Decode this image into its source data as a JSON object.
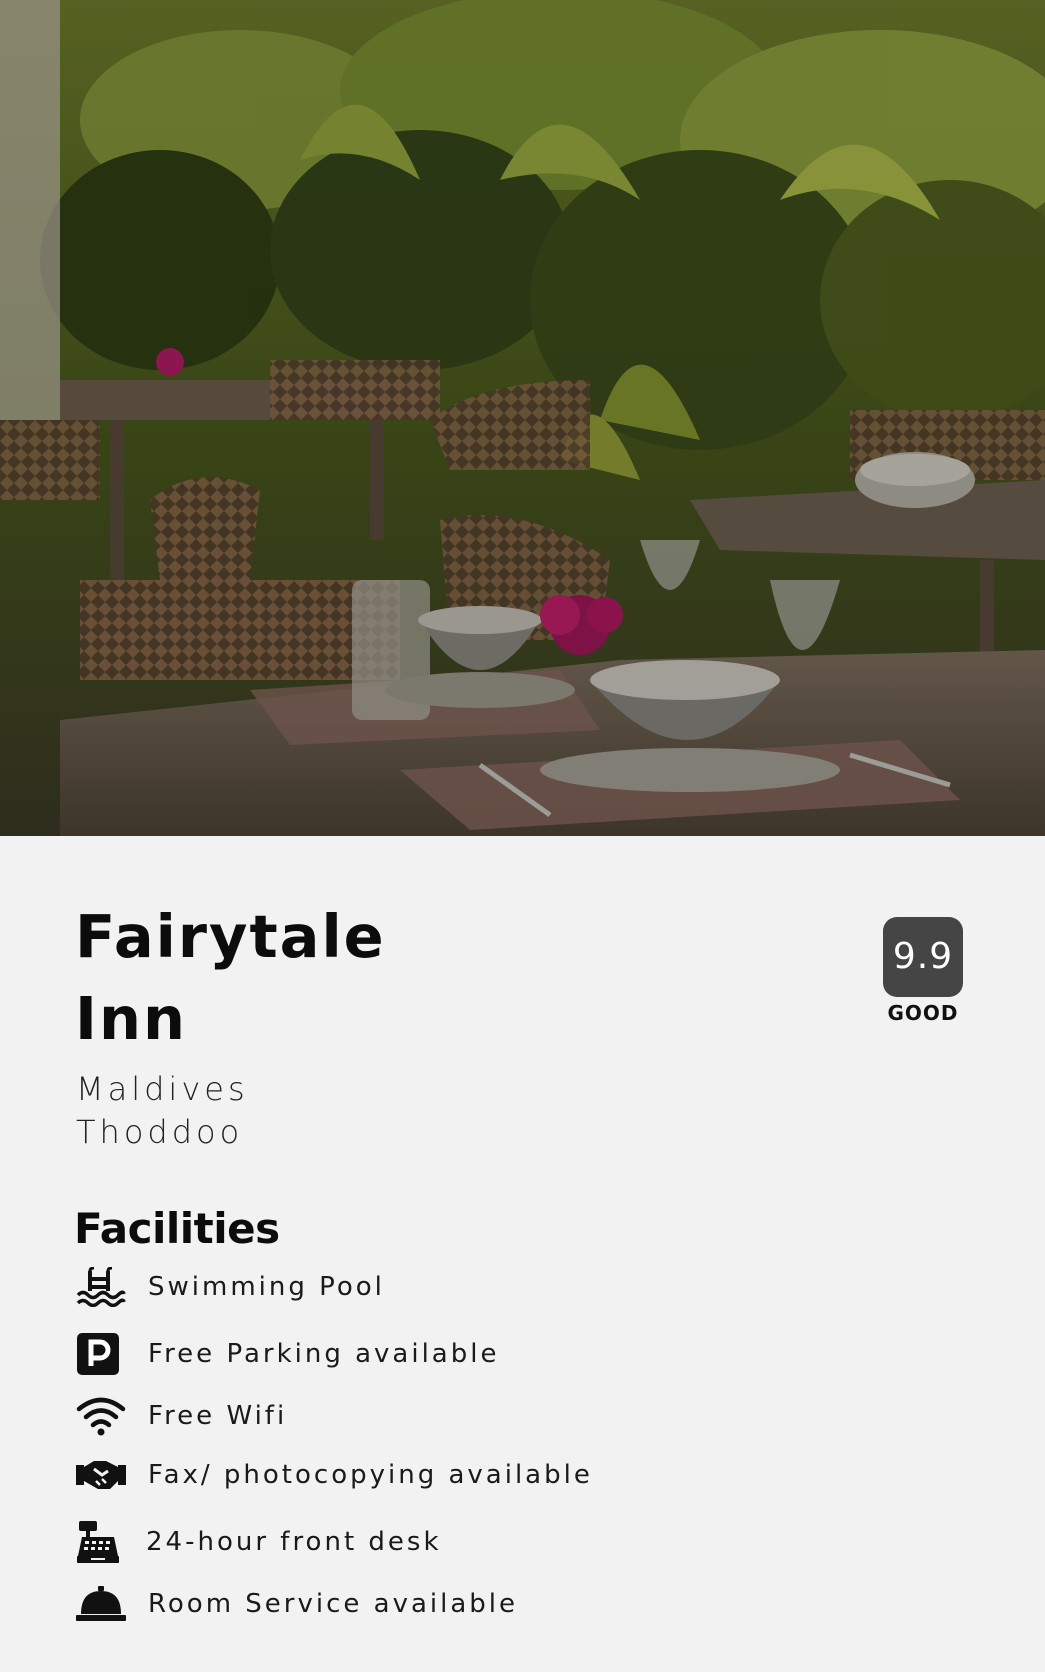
{
  "hotel": {
    "name_line1": "Fairytale",
    "name_line2": "Inn",
    "country": "Maldives",
    "island": "Thoddoo"
  },
  "rating": {
    "score": "9.9",
    "label": "GOOD"
  },
  "facilities": {
    "heading": "Facilities",
    "items": [
      {
        "icon": "swimming-pool-icon",
        "label": "Swimming Pool"
      },
      {
        "icon": "parking-icon",
        "label": "Free Parking available"
      },
      {
        "icon": "wifi-icon",
        "label": "Free Wifi"
      },
      {
        "icon": "handshake-icon",
        "label": "Fax/ photocopying available"
      },
      {
        "icon": "cash-register-icon",
        "label": "24-hour front desk"
      },
      {
        "icon": "service-bell-icon",
        "label": "Room Service available"
      }
    ]
  },
  "colors": {
    "background": "#f2f2f2",
    "rating_badge": "#454545",
    "text": "#111111"
  }
}
